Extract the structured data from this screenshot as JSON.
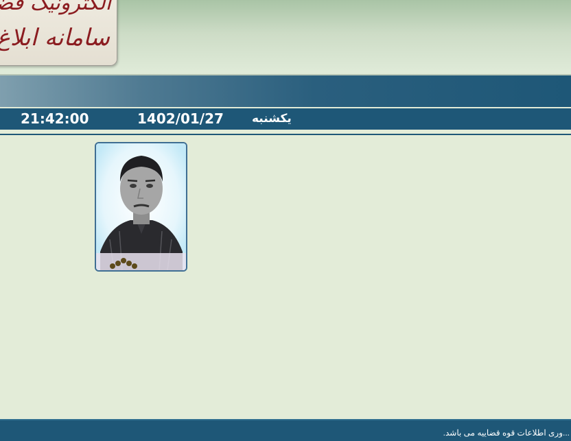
{
  "header": {
    "logo_line1": "الکترونیک قضایی",
    "logo_line2": "سامانه ابلاغ"
  },
  "date_bar": {
    "time": "21:42:00",
    "date": "1402/01/27",
    "weekday": "یکشنبه"
  },
  "profile": {
    "photo_icon": "person-photo"
  },
  "footer": {
    "text": "...وری اطلاعات قوه قضاییه می باشد."
  },
  "colors": {
    "page_bg": "#e3ecd8",
    "bar": "#1e5777",
    "logo_text": "#8b1c20"
  }
}
